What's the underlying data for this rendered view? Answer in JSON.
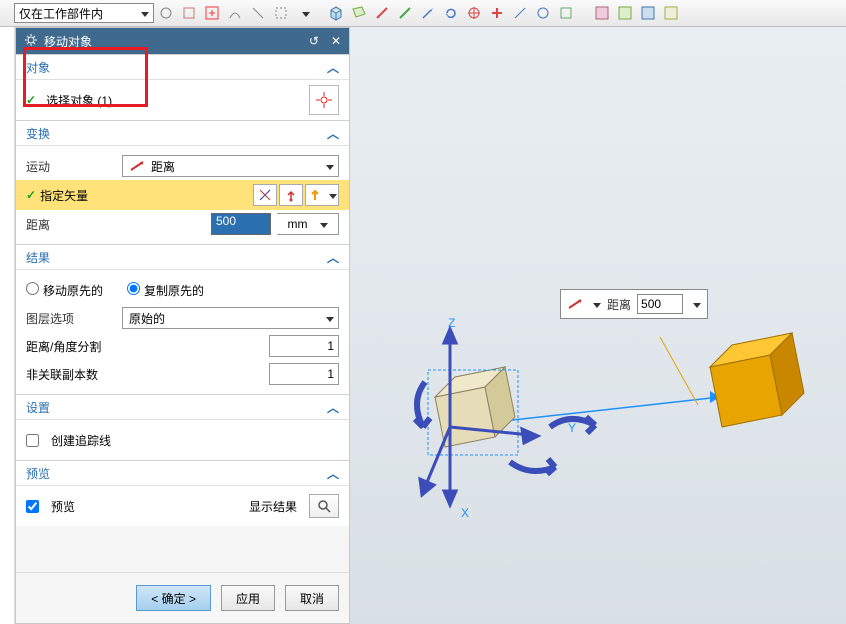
{
  "toolbar": {
    "filter": "仅在工作部件内"
  },
  "panel": {
    "title": "移动对象",
    "sections": {
      "object": {
        "title": "对象",
        "select_label": "选择对象 (1)"
      },
      "transform": {
        "title": "变换",
        "motion_label": "运动",
        "motion_value": "距离",
        "vector_label": "指定矢量",
        "distance_label": "距离",
        "distance_value": "500",
        "distance_unit": "mm"
      },
      "result": {
        "title": "结果",
        "radio_move": "移动原先的",
        "radio_copy": "复制原先的",
        "layer_label": "图层选项",
        "layer_value": "原始的",
        "divide_label": "距离/角度分割",
        "divide_value": "1",
        "copies_label": "非关联副本数",
        "copies_value": "1"
      },
      "settings": {
        "title": "设置",
        "trace_label": "创建追踪线"
      },
      "preview": {
        "title": "预览",
        "preview_label": "预览",
        "show_result": "显示结果"
      }
    },
    "buttons": {
      "ok": "< 确定 >",
      "apply": "应用",
      "cancel": "取消"
    }
  },
  "viewport": {
    "axis_x": "X",
    "axis_y": "Y",
    "axis_z": "Z",
    "float_label": "距离",
    "float_value": "500"
  }
}
